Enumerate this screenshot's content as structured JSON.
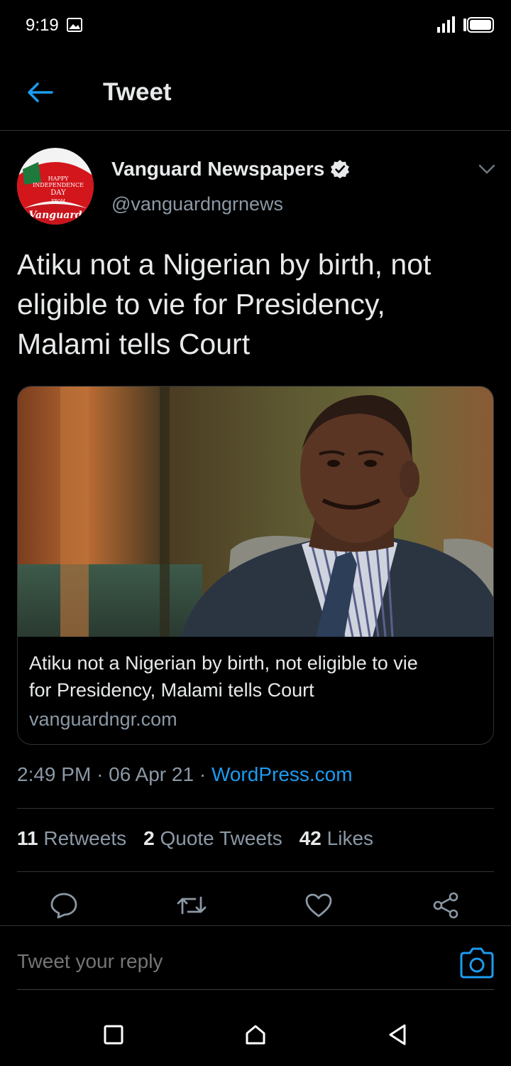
{
  "status_bar": {
    "time": "9:19"
  },
  "header": {
    "title": "Tweet"
  },
  "author": {
    "name": "Vanguard Newspapers",
    "handle": "@vanguardngrnews",
    "avatar_text": [
      "HAPPY",
      "INDEPENDENCE",
      "DAY",
      "FROM",
      "Vanguard"
    ]
  },
  "tweet": {
    "text_lines": [
      "Atiku not a Nigerian by birth, not",
      "eligible to vie for Presidency,",
      "Malami tells Court"
    ]
  },
  "card": {
    "title_lines": [
      "Atiku not a Nigerian by birth, not eligible to vie",
      "for Presidency, Malami tells Court"
    ],
    "domain": "vanguardngr.com"
  },
  "meta": {
    "time": "2:49 PM",
    "date": "06 Apr 21",
    "separator": "·",
    "source": "WordPress.com"
  },
  "stats": {
    "retweets_count": "11",
    "retweets_label": "Retweets",
    "quotes_count": "2",
    "quotes_label": "Quote Tweets",
    "likes_count": "42",
    "likes_label": "Likes"
  },
  "reply": {
    "placeholder": "Tweet your reply"
  },
  "colors": {
    "background": "#000000",
    "accent": "#1d9bf0",
    "secondary_text": "#8b98a5"
  }
}
